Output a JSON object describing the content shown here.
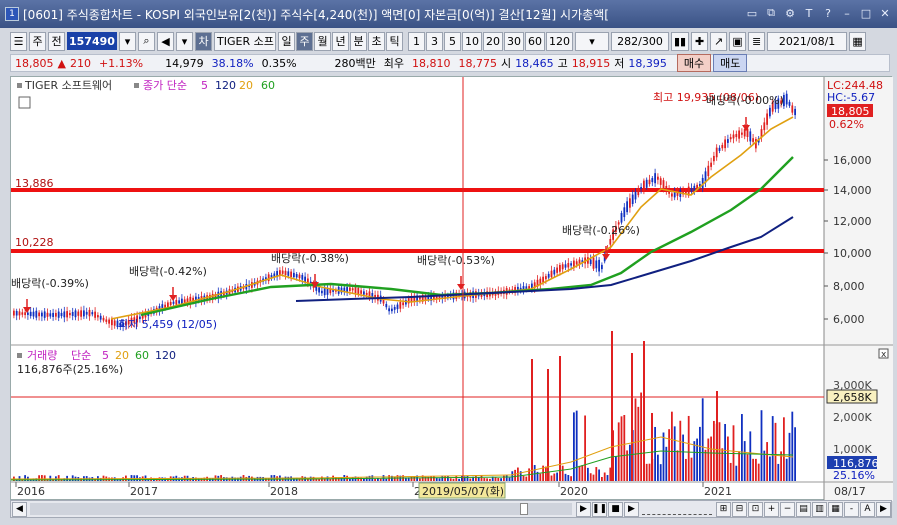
{
  "window": {
    "number": "1",
    "title": "[0601] 주식종합차트 - KOSPI 외국인보유[2(천)] 주식수[4,240(천)] 액면[0] 자본금[0(억)] 결산[12월] 시가총액["
  },
  "toolbar": {
    "type_label": "주",
    "all_label": "전",
    "code": "157490",
    "stock_name": "TIGER 소프",
    "periods": [
      "일",
      "주",
      "월",
      "년",
      "분",
      "초",
      "틱"
    ],
    "selected_period": "주",
    "numbers": [
      "1",
      "3",
      "5",
      "10",
      "20",
      "30",
      "60",
      "120"
    ],
    "count": "282/300",
    "date": "2021/08/1"
  },
  "quote": {
    "price": "18,805",
    "change": "210",
    "change_pct": "+1.13%",
    "volume": "14,979",
    "ratio": "38.18%",
    "ratio2": "0.35%",
    "amount": "280백만",
    "label_best": "최우",
    "best_sell": "18,810",
    "best_buy": "18,775",
    "open_label": "시",
    "open": "18,465",
    "high_label": "고",
    "high": "18,915",
    "low_label": "저",
    "low": "18,395",
    "buy_label": "매수",
    "sell_label": "매도"
  },
  "price_panel": {
    "legend_name": "TIGER 소프트웨어",
    "legend_ma": "종가 단순",
    "ma_periods": [
      "5",
      "120",
      "20",
      "60"
    ],
    "lc": "LC:244.48",
    "hc": "HC:-5.67",
    "current": "18,805",
    "current_pct": "0.62%",
    "hline1_label": "13,886",
    "hline2_label": "10,228",
    "high_note": "최고 19,935 (08/06)",
    "low_note": "최저 5,459 (12/05)",
    "y_ticks": [
      "16,000",
      "14,000",
      "12,000",
      "10,000",
      "8,000",
      "6,000"
    ],
    "dividend_notes": [
      "배당락(-0.39%)",
      "배당락(-0.42%)",
      "배당락(-0.38%)",
      "배당락(-0.53%)",
      "배당락(-0.26%)",
      "배당락(-0.00%)"
    ]
  },
  "volume_panel": {
    "legend_name": "거래량",
    "legend_ma": "단순",
    "ma_periods": [
      "5",
      "20",
      "60",
      "120"
    ],
    "info": "116,876주(25.16%)",
    "y_ticks": [
      "3,000K",
      "2,000K",
      "1,000K"
    ],
    "hline_value": "2,658K",
    "last_value": "116,876",
    "last_pct": "25.16%"
  },
  "x_axis": {
    "labels": [
      "2016",
      "2017",
      "2018",
      "2019",
      "2020",
      "2021",
      "08/17"
    ],
    "cursor_date": "2019/05/07(화)"
  },
  "colors": {
    "up": "#e02020",
    "down": "#1030c0",
    "ma5": "#c020c0",
    "ma20": "#e0a010",
    "ma60": "#20a020",
    "ma120": "#102080",
    "hline": "#ee1111"
  }
}
